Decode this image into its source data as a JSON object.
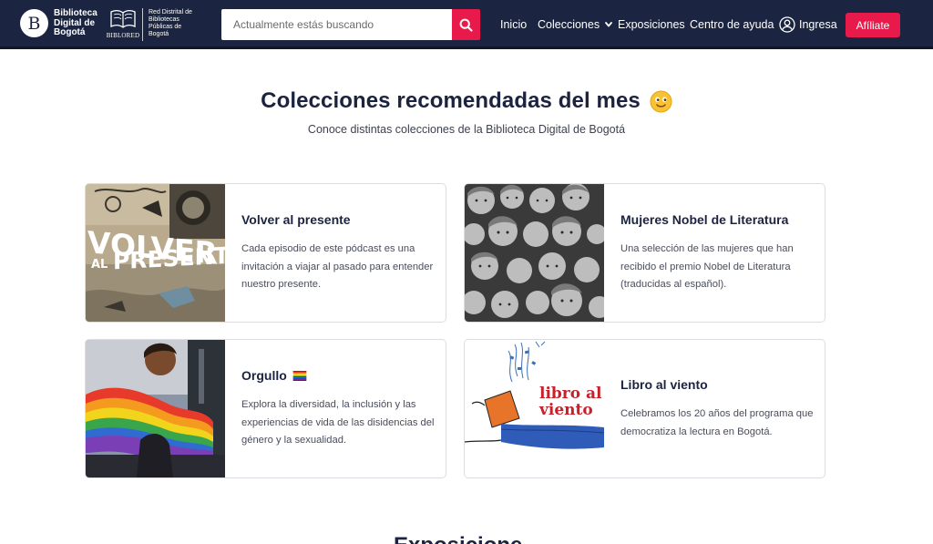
{
  "header": {
    "brand_bdb": "Biblioteca Digital de Bogotá",
    "brand_bdb_letter": "B",
    "brand_biblored": "BIBLORED",
    "brand_red": "Red Distrital de Bibliotecas Públicas de Bogotá",
    "search_placeholder": "Actualmente estás buscando",
    "search_icon": "search-icon",
    "nav": {
      "inicio": "Inicio",
      "colecciones": "Colecciones",
      "exposiciones": "Exposiciones",
      "ayuda": "Centro de ayuda",
      "ingresa": "Ingresa"
    },
    "cta": "Afíliate",
    "colors": {
      "bar": "#1b2541",
      "accent": "#e8194b"
    }
  },
  "section": {
    "title": "Colecciones recomendadas del mes",
    "title_emoji": "smiling-face-emoji",
    "subtitle": "Conoce distintas colecciones de la Biblioteca Digital de Bogotá"
  },
  "cards": [
    {
      "title": "Volver al presente",
      "description": "Cada episodio de este pódcast es una invitación a viajar al pasado para entender nuestro presente.",
      "thumb_text": [
        "VOLVER",
        "AL",
        "PRESENTE"
      ]
    },
    {
      "title": "Mujeres Nobel de Literatura",
      "description": "Una selección de las mujeres que han recibido el premio Nobel de Literatura (traducidas al español).",
      "thumb_text": []
    },
    {
      "title": "Orgullo",
      "title_icon": "rainbow-flag-icon",
      "description": "Explora la diversidad, la inclusión y las experiencias de vida de las disidencias del género y la sexualidad.",
      "thumb_text": []
    },
    {
      "title": "Libro al viento",
      "description": "Celebramos los 20 años del programa que democratiza la lectura en Bogotá.",
      "thumb_text": [
        "libro al",
        "viento"
      ]
    }
  ],
  "next_section": {
    "title": "Exposiciones"
  }
}
